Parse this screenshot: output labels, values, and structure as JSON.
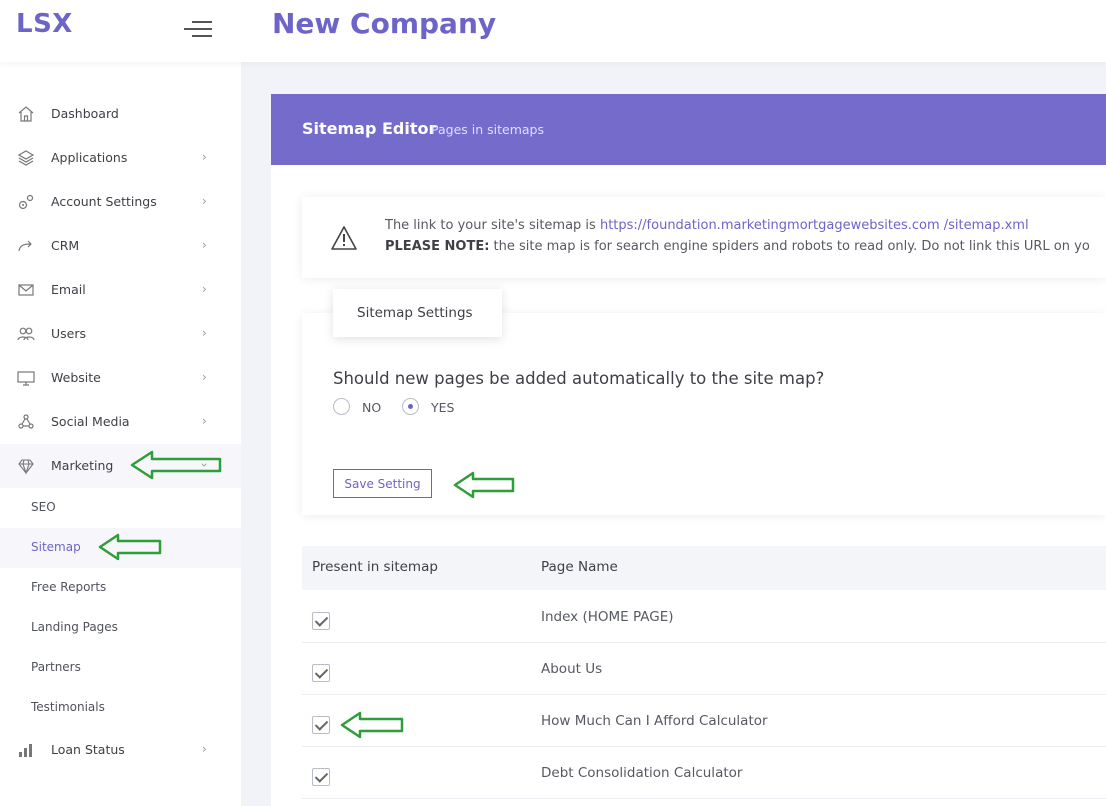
{
  "header": {
    "brand": "LSX",
    "company": "New Company"
  },
  "sidebar": {
    "items": [
      {
        "label": "Dashboard",
        "icon": "home-icon"
      },
      {
        "label": "Applications",
        "icon": "layers-icon"
      },
      {
        "label": "Account Settings",
        "icon": "gears-icon"
      },
      {
        "label": "CRM",
        "icon": "share-arrow-icon"
      },
      {
        "label": "Email",
        "icon": "envelope-icon"
      },
      {
        "label": "Users",
        "icon": "users-icon"
      },
      {
        "label": "Website",
        "icon": "monitor-icon"
      },
      {
        "label": "Social Media",
        "icon": "network-icon"
      },
      {
        "label": "Marketing",
        "icon": "diamond-icon"
      }
    ],
    "sub_items": [
      "SEO",
      "Sitemap",
      "Free Reports",
      "Landing Pages",
      "Partners",
      "Testimonials"
    ],
    "last_item": {
      "label": "Loan Status",
      "icon": "bar-chart-icon"
    }
  },
  "panel": {
    "title": "Sitemap Editor",
    "subtitle": "Pages in sitemaps"
  },
  "notice": {
    "prefix": "The link to your site's sitemap is ",
    "url": "https://foundation.marketingmortgagewebsites.com /sitemap.xml",
    "bold": "PLEASE NOTE:",
    "text": " the site map is for search engine spiders and robots to read only. Do not link this URL on yo"
  },
  "settings": {
    "tab": "Sitemap Settings",
    "question": "Should new pages be added automatically to the site map?",
    "option_no": "NO",
    "option_yes": "YES",
    "selected": "YES",
    "save_label": "Save Setting"
  },
  "table": {
    "headers": [
      "Present in sitemap",
      "Page Name"
    ],
    "rows": [
      {
        "name": "Index (HOME PAGE)",
        "checked": true
      },
      {
        "name": "About Us",
        "checked": true
      },
      {
        "name": "How Much Can I Afford Calculator",
        "checked": true
      },
      {
        "name": "Debt Consolidation Calculator",
        "checked": true
      }
    ]
  },
  "colors": {
    "accent": "#6d64c9",
    "panel_header": "#756bcb",
    "annotation_arrow": "#2e9e3a"
  }
}
